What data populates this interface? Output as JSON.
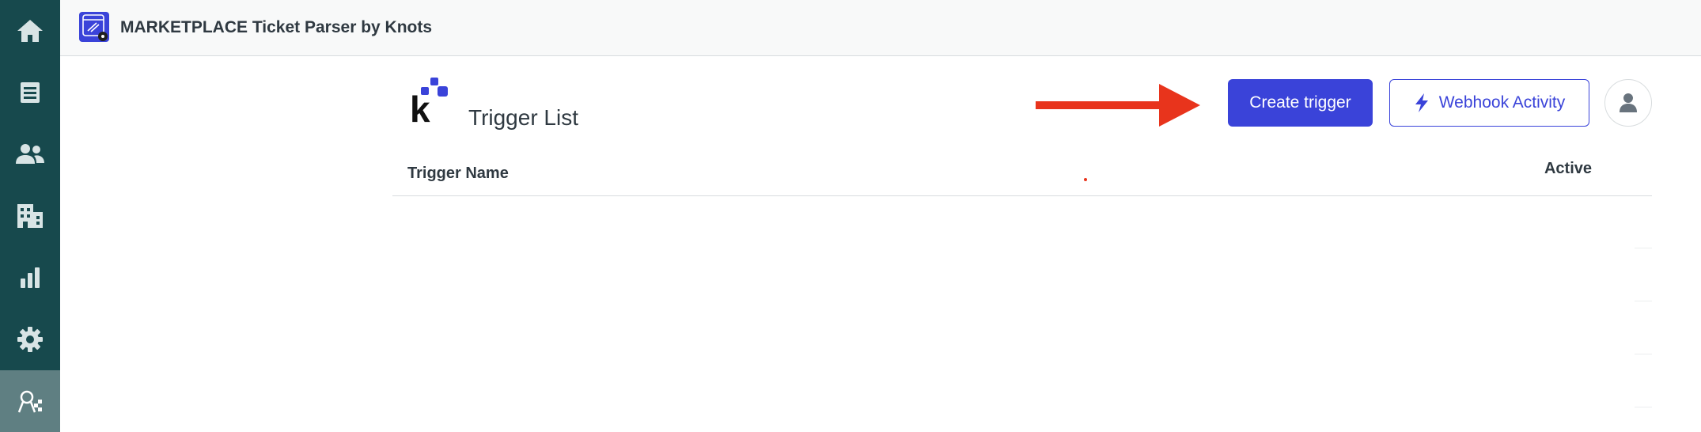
{
  "header": {
    "app_title": "MARKETPLACE Ticket Parser by Knots"
  },
  "sidebar": {
    "items": [
      {
        "name": "home",
        "icon": "home-icon"
      },
      {
        "name": "views",
        "icon": "views-icon"
      },
      {
        "name": "customers",
        "icon": "customers-icon"
      },
      {
        "name": "organizations",
        "icon": "organizations-icon"
      },
      {
        "name": "reporting",
        "icon": "bar-chart-icon"
      },
      {
        "name": "admin",
        "icon": "gear-icon"
      },
      {
        "name": "app",
        "icon": "app-icon",
        "active": true
      }
    ]
  },
  "main": {
    "title": "Trigger List",
    "create_button": "Create trigger",
    "webhook_button": "Webhook Activity",
    "table": {
      "columns": [
        "Trigger Name",
        "Active"
      ],
      "rows": []
    }
  },
  "colors": {
    "sidebar": "#17494d",
    "sidebar_active": "#5f7f82",
    "primary": "#3a43d9",
    "annotation_arrow": "#e8341c"
  }
}
